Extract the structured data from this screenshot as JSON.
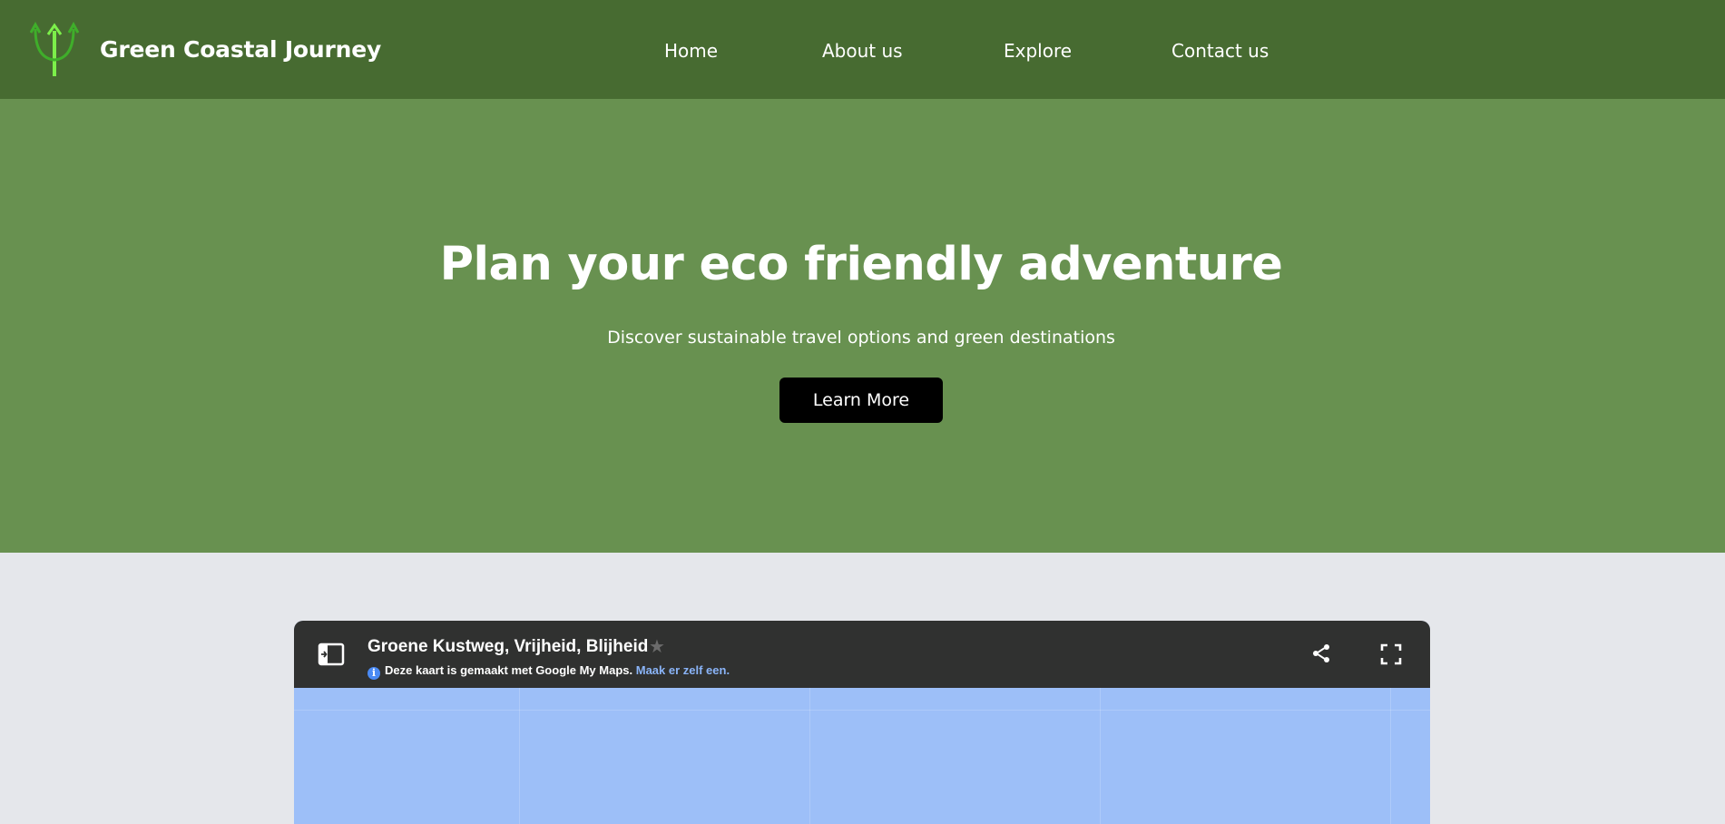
{
  "header": {
    "brand": "Green Coastal Journey",
    "logo_icon": "trident-arrows-icon",
    "nav": [
      {
        "label": "Home"
      },
      {
        "label": "About us"
      },
      {
        "label": "Explore"
      },
      {
        "label": "Contact us"
      }
    ],
    "background": "#476b31"
  },
  "hero": {
    "title": "Plan your eco friendly adventure",
    "subtitle": "Discover sustainable travel options and green destinations",
    "button_label": "Learn More",
    "background": "#689150"
  },
  "map": {
    "title": "Groene Kustweg, Vrijheid, Blijheid",
    "info_text": "Deze kaart is gemaakt met Google My Maps.",
    "info_link": "Maak er zelf een.",
    "icons": [
      "sidebar-toggle-icon",
      "star-icon",
      "info-icon",
      "share-icon",
      "fullscreen-icon"
    ],
    "water_color": "#9dbff8"
  }
}
